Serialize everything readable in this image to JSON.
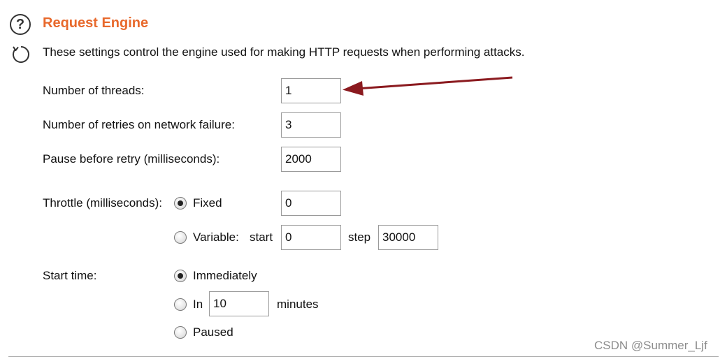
{
  "section": {
    "title": "Request Engine",
    "description": "These settings control the engine used for making HTTP requests when performing attacks.",
    "help_icon": "question-mark-icon",
    "refresh_icon": "refresh-icon"
  },
  "fields": {
    "threads_label": "Number of threads:",
    "threads_value": "1",
    "retries_label": "Number of retries on network failure:",
    "retries_value": "3",
    "pause_label": "Pause before retry (milliseconds):",
    "pause_value": "2000"
  },
  "throttle": {
    "label": "Throttle (milliseconds):",
    "fixed_label": "Fixed",
    "fixed_selected": true,
    "fixed_value": "0",
    "variable_label": "Variable:",
    "start_label": "start",
    "start_value": "0",
    "step_label": "step",
    "step_value": "30000"
  },
  "start_time": {
    "label": "Start time:",
    "immediately_label": "Immediately",
    "immediately_selected": true,
    "in_label": "In",
    "in_value": "10",
    "minutes_label": "minutes",
    "paused_label": "Paused"
  },
  "annotation": {
    "arrow_color": "#8b1a1f"
  },
  "accent_color": "#e8692c",
  "watermark": "CSDN @Summer_Ljf"
}
